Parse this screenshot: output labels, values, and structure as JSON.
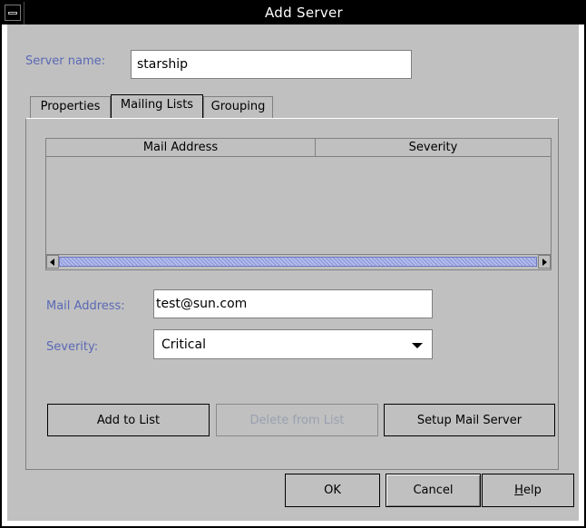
{
  "window": {
    "title": "Add Server"
  },
  "server": {
    "label": "Server name:",
    "value": "starship"
  },
  "tabs": [
    {
      "label": "Properties",
      "active": false
    },
    {
      "label": "Mailing Lists",
      "active": true
    },
    {
      "label": "Grouping",
      "active": false
    }
  ],
  "table": {
    "columns": [
      "Mail Address",
      "Severity"
    ],
    "rows": []
  },
  "mail_form": {
    "address_label": "Mail Address:",
    "address_value": "test@sun.com",
    "severity_label": "Severity:",
    "severity_value": "Critical"
  },
  "list_buttons": {
    "add": "Add to List",
    "delete": "Delete from List",
    "setup": "Setup Mail Server"
  },
  "dialog_buttons": {
    "ok": "OK",
    "cancel": "Cancel",
    "help_mnemonic": "H",
    "help_rest": "elp"
  },
  "colors": {
    "label_blue": "#5a69b5",
    "scroll_thumb": "#9aa4e0",
    "panel_bg": "#c0c0c0",
    "titlebar_bg": "#000000"
  }
}
